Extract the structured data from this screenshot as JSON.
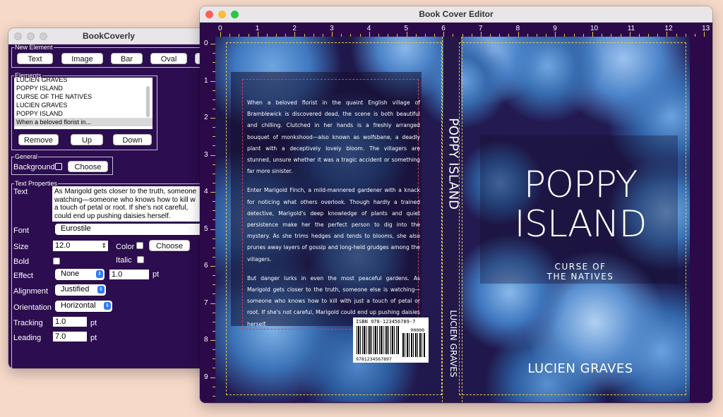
{
  "panel": {
    "title": "BookCoverly",
    "new_element": {
      "legend": "New Element",
      "buttons": [
        "Text",
        "Image",
        "Bar",
        "Oval"
      ]
    },
    "elements": {
      "legend": "Elements",
      "items": [
        "LUCIEN GRAVES",
        "POPPY ISLAND",
        "CURSE OF THE NATIVES",
        "LUCIEN GRAVES",
        "POPPY ISLAND",
        "When a beloved florist in..."
      ],
      "selected_index": 5,
      "remove_label": "Remove",
      "up_label": "Up",
      "down_label": "Down"
    },
    "general": {
      "legend": "General",
      "background_label": "Background:",
      "choose_label": "Choose"
    },
    "text_properties": {
      "legend": "Text Properties",
      "text_label": "Text",
      "text_lines": [
        "As Marigold gets closer to the truth, someone",
        "watching—someone who knows how to kill w",
        "a touch of petal or root. If she's not careful,",
        "could end up pushing daisies herself."
      ],
      "font_label": "Font",
      "font_value": "Eurostile",
      "size_label": "Size",
      "size_value": "12.0",
      "color_label": "Color",
      "color_choose_label": "Choose",
      "bold_label": "Bold",
      "italic_label": "Italic",
      "effect_label": "Effect",
      "effect_value": "None",
      "effect_amount": "1.0",
      "effect_unit": "pt",
      "alignment_label": "Alignment",
      "alignment_value": "Justified",
      "orientation_label": "Orientation",
      "orientation_value": "Horizontal",
      "tracking_label": "Tracking",
      "tracking_value": "1.0",
      "tracking_unit": "pt",
      "leading_label": "Leading",
      "leading_value": "7.0",
      "leading_unit": "pt"
    }
  },
  "editor": {
    "title": "Book Cover Editor",
    "ruler_top": [
      "0",
      "1",
      "2",
      "3",
      "4",
      "5",
      "6",
      "7",
      "8",
      "9",
      "10",
      "11",
      "12",
      "13"
    ],
    "ruler_left": [
      "0",
      "1",
      "2",
      "3",
      "4",
      "5",
      "6",
      "7",
      "8",
      "9"
    ],
    "back_cover": {
      "paragraphs": [
        "When a beloved florist in the quaint English village of Bramblewick is discovered dead, the scene is both beautiful and chilling. Clutched in her hands is a freshly arranged bouquet of monkshood—also known as wolfsbane, a deadly plant with a deceptively lovely bloom. The villagers are stunned, unsure whether it was a tragic accident or something far more sinister.",
        "Enter Marigold Finch, a mild-mannered gardener with a knack for noticing what others overlook. Though hardly a trained detective, Marigold's deep knowledge of plants and quiet persistence make her the perfect person to dig into the mystery. As she trims hedges and tends to blooms, she also prunes away layers of gossip and long-held grudges among the villagers.",
        "But danger lurks in even the most peaceful gardens. As Marigold gets closer to the truth, someone else is watching—someone who knows how to kill with just a touch of petal or root. If she's not careful, Marigold could end up pushing daisies herself."
      ]
    },
    "spine": {
      "title": "POPPY ISLAND",
      "author": "LUCIEN GRAVES"
    },
    "front_cover": {
      "title_line1": "POPPY",
      "title_line2": "ISLAND",
      "subtitle_line1": "CURSE OF",
      "subtitle_line2": "THE NATIVES",
      "author": "LUCIEN GRAVES"
    },
    "barcode": {
      "isbn_text": "ISBN 978-123456789-7",
      "price_code": "90000",
      "number": "9781234567897"
    }
  },
  "colors": {
    "background": "#f6d9c9",
    "panel_bg": "#2c0d4f",
    "canvas_bg": "#2c0a4a",
    "guide_yellow": "#e5c84c",
    "guide_red": "#d04060",
    "accent_blue": "#2f7bf5"
  }
}
